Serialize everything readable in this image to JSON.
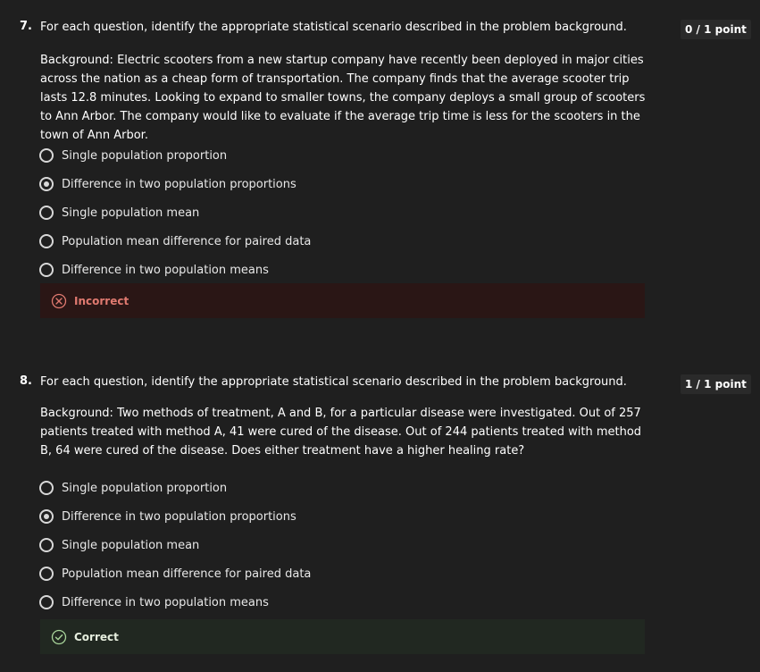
{
  "questions": [
    {
      "number": "7.",
      "prompt": "For each question, identify the appropriate statistical scenario described in the problem background.",
      "score": "0 / 1 point",
      "background": "Background: Electric scooters from a new startup company have recently been deployed in major cities across the nation as a cheap form of transportation. The company finds that the average scooter trip lasts 12.8 minutes. Looking to expand to smaller towns, the company deploys a small group of scooters to Ann Arbor. The company would like to evaluate if the average trip time is less for the scooters in the town of Ann Arbor.",
      "options": [
        {
          "label": "Single population proportion",
          "checked": false
        },
        {
          "label": "Difference in two population proportions",
          "checked": true
        },
        {
          "label": "Single population mean",
          "checked": false
        },
        {
          "label": "Population mean difference for paired data",
          "checked": false
        },
        {
          "label": "Difference in two population means",
          "checked": false
        }
      ],
      "feedback": {
        "status": "incorrect",
        "label": "Incorrect",
        "icon": "x-circle-icon",
        "color": "#e07a70"
      }
    },
    {
      "number": "8.",
      "prompt": "For each question, identify the appropriate statistical scenario described in the problem background.",
      "score": "1 / 1 point",
      "background": "Background: Two methods of treatment, A and B, for a particular disease were investigated. Out of 257 patients treated with method A, 41 were cured of the disease. Out of 244 patients treated with method B, 64 were cured of the disease. Does either treatment have a higher healing rate?",
      "options": [
        {
          "label": "Single population proportion",
          "checked": false
        },
        {
          "label": "Difference in two population proportions",
          "checked": true
        },
        {
          "label": "Single population mean",
          "checked": false
        },
        {
          "label": "Population mean difference for paired data",
          "checked": false
        },
        {
          "label": "Difference in two population means",
          "checked": false
        }
      ],
      "feedback": {
        "status": "correct",
        "label": "Correct",
        "icon": "check-circle-icon",
        "color": "#a8d49a"
      }
    }
  ]
}
